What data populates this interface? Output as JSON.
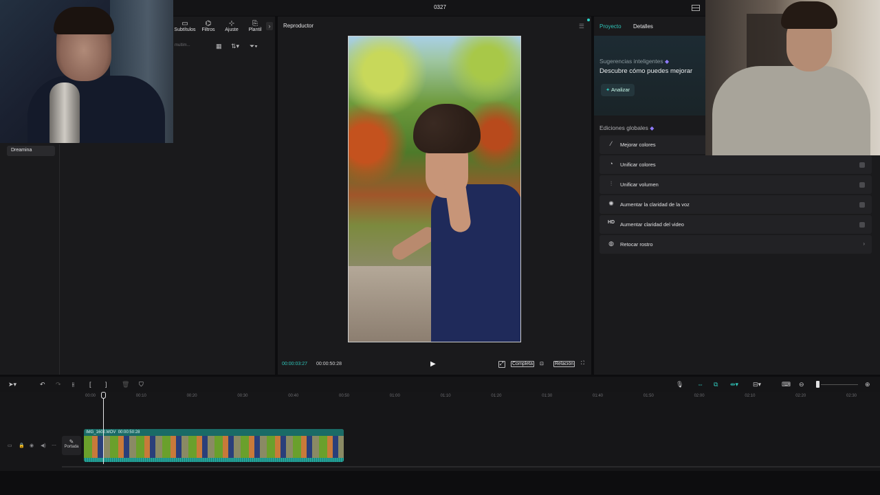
{
  "window": {
    "title": "0327"
  },
  "left_panel": {
    "tabs": [
      {
        "label": "Subtítulos",
        "icon": "subtitles-icon",
        "glyph": "▭"
      },
      {
        "label": "Filtros",
        "icon": "filters-icon",
        "glyph": "⌬"
      },
      {
        "label": "Ajuste",
        "icon": "adjust-icon",
        "glyph": "⊹"
      },
      {
        "label": "Plantil",
        "icon": "templates-icon",
        "glyph": "⎘"
      }
    ],
    "search_placeholder": "multim...",
    "sidebar_item": "Dreamina"
  },
  "player": {
    "title": "Reproductor",
    "current_time": "00:00:03:27",
    "total_time": "00:00:50:28",
    "view_mode": "Completa",
    "ratio": "Relación"
  },
  "right_panel": {
    "tabs": [
      "Proyecto",
      "Detalles"
    ],
    "smart_title": "Sugerencias inteligentes",
    "smart_subtitle": "Descubre cómo puedes mejorar",
    "analyze_label": "Analizar",
    "global_title": "Ediciones globales",
    "global_edits": [
      {
        "label": "Mejorar colores",
        "icon": "magic-wand-icon",
        "glyph": "⁄"
      },
      {
        "label": "Unificar colores",
        "icon": "color-match-icon",
        "glyph": "◔"
      },
      {
        "label": "Unificar volumen",
        "icon": "volume-sliders-icon",
        "glyph": "⫶"
      },
      {
        "label": "Aumentar la claridad de la voz",
        "icon": "voice-enhance-icon",
        "glyph": "✺"
      },
      {
        "label": "Aumentar claridad del video",
        "icon": "hd-icon",
        "glyph": "HD"
      },
      {
        "label": "Retocar rostro",
        "icon": "face-retouch-icon",
        "glyph": "◍"
      }
    ]
  },
  "timeline": {
    "ruler": [
      "00:00",
      "00:10",
      "00:20",
      "00:30",
      "00:40",
      "00:50",
      "01:00",
      "01:10",
      "01:20",
      "01:30",
      "01:40",
      "01:50",
      "02:00",
      "02:10",
      "02:20",
      "02:30"
    ],
    "cover_label": "Portada",
    "clip_name": "IMG_1602.MOV",
    "clip_duration": "00:00:50:28"
  },
  "colors": {
    "accent": "#2fc4b8",
    "panel": "#1a1a1c",
    "background": "#0d0d0f"
  }
}
